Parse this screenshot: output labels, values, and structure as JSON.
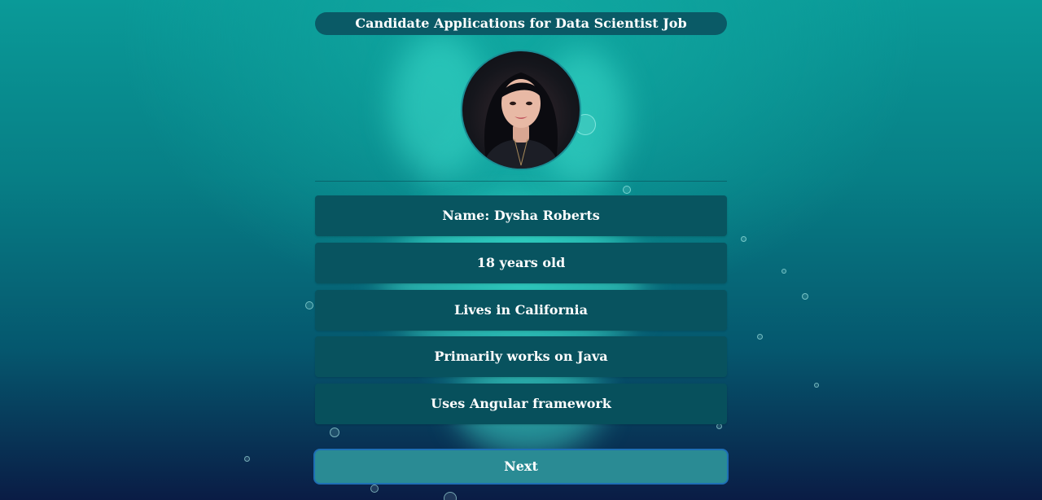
{
  "page": {
    "title": "Candidate Applications for Data Scientist Job"
  },
  "candidate": {
    "name_line": "Name: Dysha Roberts",
    "age_line": "18 years old",
    "location_line": "Lives in California",
    "language_line": "Primarily works on Java",
    "framework_line": "Uses Angular framework"
  },
  "actions": {
    "next_label": "Next"
  },
  "colors": {
    "title_bar": "#0a5a66",
    "card_dark": "#085560",
    "button_fill": "#2a8b94",
    "button_border": "#1e6fb5"
  }
}
